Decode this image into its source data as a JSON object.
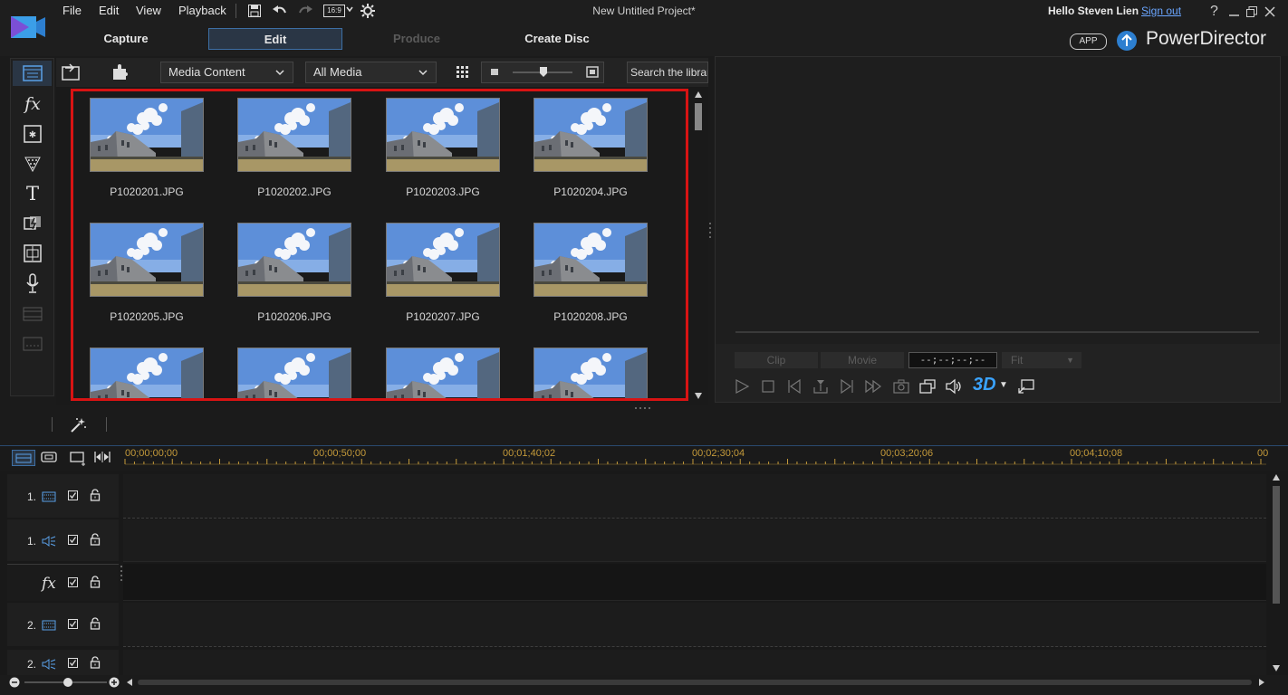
{
  "menu": {
    "file": "File",
    "edit": "Edit",
    "view": "View",
    "playback": "Playback",
    "aspect": "16:9"
  },
  "window": {
    "title": "New Untitled Project*",
    "greeting": "Hello Steven Lien",
    "signout": "Sign out",
    "help": "?",
    "app_badge": "APP",
    "brand": "PowerDirector"
  },
  "modes": {
    "capture": "Capture",
    "edit": "Edit",
    "produce": "Produce",
    "create_disc": "Create Disc"
  },
  "library": {
    "content_type": "Media Content",
    "filter": "All Media",
    "search_placeholder": "Search the library",
    "items": [
      "P1020201.JPG",
      "P1020202.JPG",
      "P1020203.JPG",
      "P1020204.JPG",
      "P1020205.JPG",
      "P1020206.JPG",
      "P1020207.JPG",
      "P1020208.JPG",
      "",
      "",
      "",
      ""
    ]
  },
  "preview": {
    "clip": "Clip",
    "movie": "Movie",
    "timecode": "--;--;--;--",
    "fit": "Fit",
    "three_d": "3D"
  },
  "timeline": {
    "ticks": [
      "00;00;00;00",
      "00;00;50;00",
      "00;01;40;02",
      "00;02;30;04",
      "00;03;20;06",
      "00;04;10;08",
      "00"
    ],
    "tracks": [
      {
        "num": "1.",
        "kind": "video"
      },
      {
        "num": "1.",
        "kind": "audio"
      },
      {
        "num": "",
        "kind": "fx"
      },
      {
        "num": "2.",
        "kind": "video"
      },
      {
        "num": "2.",
        "kind": "audio"
      }
    ]
  },
  "colors": {
    "accent": "#3d6fa5",
    "highlight": "#d81313",
    "timecode": "#c49a3a",
    "link": "#6aa6ff"
  }
}
